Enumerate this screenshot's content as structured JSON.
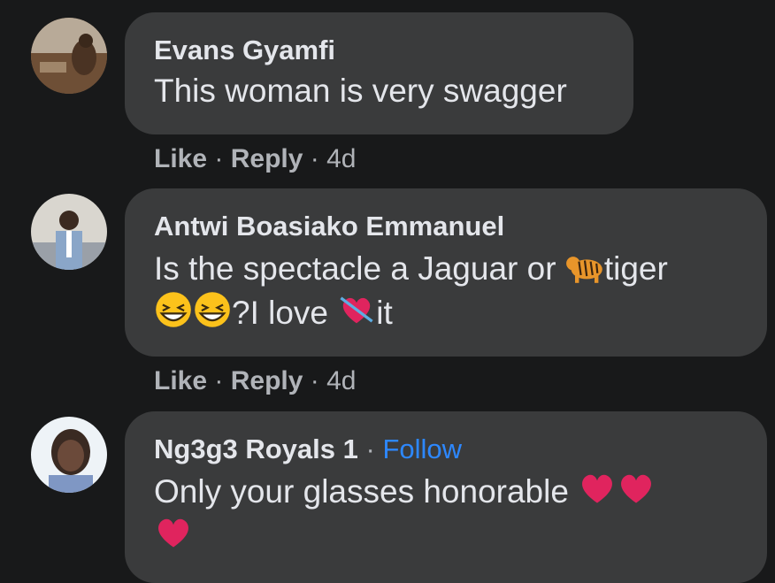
{
  "comments": [
    {
      "author": "Evans Gyamfi",
      "text_parts": [
        "This woman is very swagger"
      ],
      "actions": {
        "like": "Like",
        "reply": "Reply",
        "time": "4d"
      },
      "avatar_icon": "user-avatar-photo"
    },
    {
      "author": "Antwi Boasiako Emmanuel",
      "text_line1_a": "Is the spectacle a Jaguar or ",
      "text_line1_b": "tiger",
      "text_line2_a": "?I love ",
      "text_line2_b": "it",
      "emojis": [
        "tiger-emoji",
        "grinning-squint-emoji",
        "heart-with-arrow-emoji"
      ],
      "actions": {
        "like": "Like",
        "reply": "Reply",
        "time": "4d"
      },
      "avatar_icon": "user-avatar-photo"
    },
    {
      "author": "Ng3g3 Royals 1",
      "follow_label": "Follow",
      "text_line1": "Only your glasses honorable ",
      "emojis": [
        "red-heart-emoji",
        "red-heart-emoji",
        "red-heart-emoji"
      ],
      "avatar_icon": "user-avatar-photo"
    }
  ],
  "separator": "·",
  "colors": {
    "background": "#18191a",
    "bubble": "#3a3b3c",
    "primary_text": "#e4e6eb",
    "secondary_text": "#b0b3b8",
    "link": "#2d88ff"
  }
}
